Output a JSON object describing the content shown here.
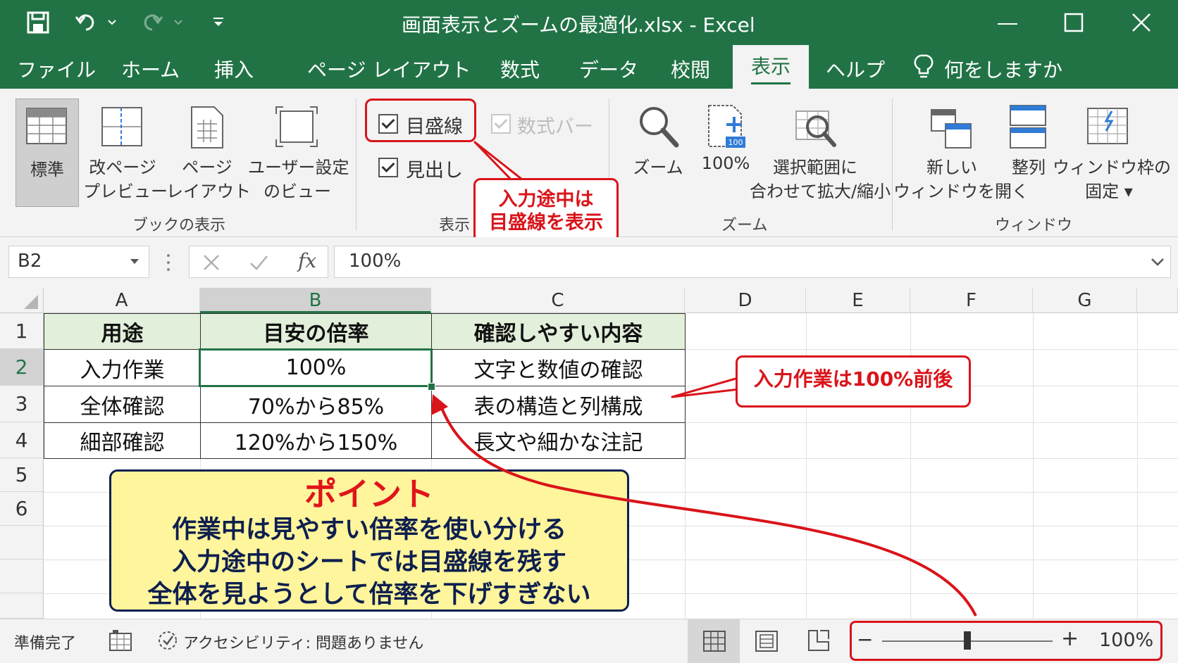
{
  "window": {
    "title": "画面表示とズームの最適化.xlsx  -  Excel",
    "minimize_icon": "minimize-icon",
    "maximize_icon": "maximize-icon",
    "close_icon": "close-icon"
  },
  "tabs": [
    "ファイル",
    "ホーム",
    "挿入",
    "ページ レイアウト",
    "数式",
    "データ",
    "校閲",
    "表示",
    "ヘルプ"
  ],
  "active_tab": "表示",
  "tell_me": "何をしますか",
  "ribbon": {
    "workbook_views": {
      "group": "ブックの表示",
      "normal": "標準",
      "page_break_1": "改ページ",
      "page_break_2": "プレビュー",
      "page_layout_1": "ページ",
      "page_layout_2": "レイアウト",
      "custom_1": "ユーザー設定",
      "custom_2": "のビュー"
    },
    "show": {
      "group": "表示",
      "gridlines": "目盛線",
      "formula_bar": "数式バー",
      "headings": "見出し"
    },
    "zoom": {
      "group": "ズーム",
      "zoom": "ズーム",
      "hundred": "100%",
      "selection_1": "選択範囲に",
      "selection_2": "合わせて拡大/縮小"
    },
    "window": {
      "group": "ウィンドウ",
      "new_1": "新しい",
      "new_2": "ウィンドウを開く",
      "arrange": "整列",
      "freeze_1": "ウィンドウ枠の",
      "freeze_2": "固定 ▾"
    }
  },
  "callouts": {
    "gridlines_1": "入力途中は",
    "gridlines_2": "目盛線を表示",
    "zoom": "入力作業は100%前後"
  },
  "formula_bar": {
    "name_box": "B2",
    "fx": "fx",
    "value": "100%"
  },
  "columns": [
    "A",
    "B",
    "C",
    "D",
    "E",
    "F",
    "G"
  ],
  "rows": [
    "1",
    "2",
    "3",
    "4",
    "5",
    "6"
  ],
  "table": {
    "headers": [
      "用途",
      "目安の倍率",
      "確認しやすい内容"
    ],
    "rows": [
      [
        "入力作業",
        "100%",
        "文字と数値の確認"
      ],
      [
        "全体確認",
        "70%から85%",
        "表の構造と列構成"
      ],
      [
        "細部確認",
        "120%から150%",
        "長文や細かな注記"
      ]
    ]
  },
  "point": {
    "title": "ポイント",
    "lines": [
      "作業中は見やすい倍率を使い分ける",
      "入力途中のシートでは目盛線を残す",
      "全体を見ようとして倍率を下げすぎない"
    ]
  },
  "status": {
    "ready": "準備完了",
    "accessibility": "アクセシビリティ: 問題ありません",
    "zoom_minus": "−",
    "zoom_plus": "+",
    "zoom_value": "100%",
    "zoom_level_percent": 100
  },
  "colors": {
    "excel_green": "#217346",
    "callout_red": "#d9141a",
    "header_fill": "#e2efda",
    "point_fill": "#fef59c",
    "point_title": "#e0141a",
    "point_text": "#0e1f4f"
  }
}
